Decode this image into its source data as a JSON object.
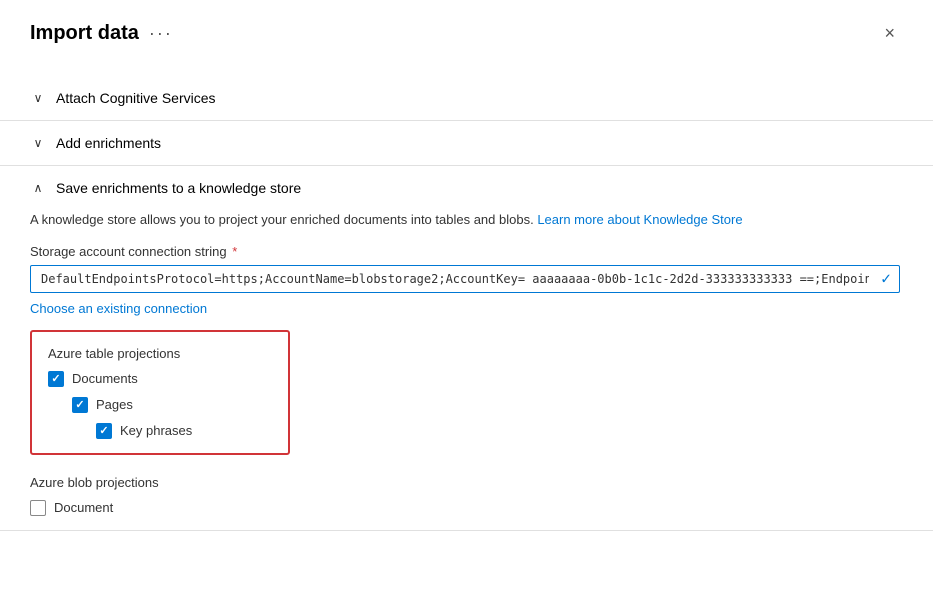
{
  "panel": {
    "title": "Import data",
    "close_label": "×",
    "dots_label": "···"
  },
  "sections": [
    {
      "id": "attach-cognitive",
      "label": "Attach Cognitive Services",
      "expanded": false,
      "chevron": "∨"
    },
    {
      "id": "add-enrichments",
      "label": "Add enrichments",
      "expanded": false,
      "chevron": "∨"
    },
    {
      "id": "save-enrichments",
      "label": "Save enrichments to a knowledge store",
      "expanded": true,
      "chevron": "∧"
    }
  ],
  "knowledge_store": {
    "description_start": "A knowledge store allows you to project your enriched documents into tables and blobs.",
    "link_text": "Learn more about Knowledge Store",
    "field_label": "Storage account connection string",
    "field_required": true,
    "field_value": "DefaultEndpointsProtocol=https;AccountName=blobstorage2;AccountKey= aaaaaaaa-0b0b-1c1c-2d2d-333333333333 ==;EndpointSu",
    "field_placeholder": "DefaultEndpointsProtocol=https;AccountName=blobstorage2;AccountKey= aaaaaaaa-0b0b-1c1c-2d2d-333333333333 ==;EndpointSu",
    "choose_connection": "Choose an existing connection",
    "table_projections_label": "Azure table projections",
    "checkboxes": [
      {
        "id": "documents",
        "label": "Documents",
        "checked": true,
        "indent": 0
      },
      {
        "id": "pages",
        "label": "Pages",
        "checked": true,
        "indent": 1
      },
      {
        "id": "key-phrases",
        "label": "Key phrases",
        "checked": true,
        "indent": 2
      }
    ],
    "blob_projections_label": "Azure blob projections",
    "blob_checkboxes": [
      {
        "id": "document-blob",
        "label": "Document",
        "checked": false,
        "indent": 0
      }
    ]
  }
}
